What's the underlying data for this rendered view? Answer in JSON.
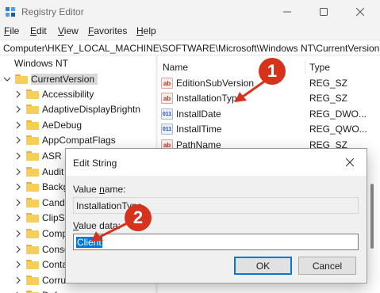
{
  "window": {
    "title": "Registry Editor",
    "controls": {
      "minimize": "minimize",
      "maximize": "maximize",
      "close": "close"
    }
  },
  "menu": [
    {
      "label": "File",
      "key": "F",
      "rest": "ile"
    },
    {
      "label": "Edit",
      "key": "E",
      "rest": "dit"
    },
    {
      "label": "View",
      "key": "V",
      "rest": "iew"
    },
    {
      "label": "Favorites",
      "key": "F",
      "rest": "avorites"
    },
    {
      "label": "Help",
      "key": "H",
      "rest": "elp"
    }
  ],
  "address": {
    "path": "Computer\\HKEY_LOCAL_MACHINE\\SOFTWARE\\Microsoft\\Windows NT\\CurrentVersion"
  },
  "tree": {
    "parent": "Windows NT",
    "selected": "CurrentVersion",
    "children": [
      "Accessibility",
      "AdaptiveDisplayBrightn",
      "AeDebug",
      "AppCompatFlags",
      "ASR",
      "Audit",
      "Backg",
      "Candi",
      "ClipSV",
      "Comp",
      "Conso",
      "Conta",
      "Corru",
      "Defau"
    ]
  },
  "list": {
    "headers": {
      "name": "Name",
      "type": "Type"
    },
    "rows": [
      {
        "icon": "ab",
        "name": "EditionSubVersion",
        "type": "REG_SZ"
      },
      {
        "icon": "ab",
        "name": "InstallationType",
        "type": "REG_SZ"
      },
      {
        "icon": "bin",
        "name": "InstallDate",
        "type": "REG_DWO..."
      },
      {
        "icon": "bin",
        "name": "InstallTime",
        "type": "REG_QWO..."
      },
      {
        "icon": "ab",
        "name": "PathName",
        "type": "REG_SZ"
      }
    ]
  },
  "dialog": {
    "title": "Edit String",
    "value_name_label": {
      "pre": "Value ",
      "key": "n",
      "post": "ame:"
    },
    "value_name": "InstallationType",
    "value_data_label": {
      "pre": "",
      "key": "V",
      "post": "alue data:"
    },
    "value_data": "Client",
    "ok": "OK",
    "cancel": "Cancel"
  },
  "callouts": {
    "first": "1",
    "second": "2"
  },
  "colors": {
    "callout": "#d7321c",
    "selection": "#0078d7",
    "folder": "#f6cf5a"
  }
}
